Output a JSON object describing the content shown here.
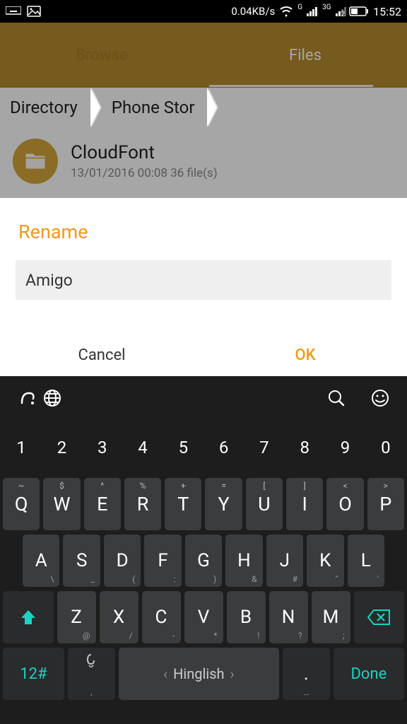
{
  "status": {
    "speed": "0.04KB/s",
    "g": "G",
    "net_label": "3G",
    "time": "15:52"
  },
  "tabs": {
    "browse": "Browse",
    "files": "Files"
  },
  "breadcrumb": {
    "first": "Directory",
    "second": "Phone Stor"
  },
  "file": {
    "name": "CloudFont",
    "meta": "13/01/2016 00:08  36 file(s)"
  },
  "dialog": {
    "title": "Rename",
    "value": "Amigo",
    "cancel": "Cancel",
    "ok": "OK"
  },
  "keyboard": {
    "nums": [
      "1",
      "2",
      "3",
      "4",
      "5",
      "6",
      "7",
      "8",
      "9",
      "0"
    ],
    "row1": [
      {
        "k": "Q",
        "s": "~"
      },
      {
        "k": "W",
        "s": "$"
      },
      {
        "k": "E",
        "s": "^"
      },
      {
        "k": "R",
        "s": "%"
      },
      {
        "k": "T",
        "s": "+"
      },
      {
        "k": "Y",
        "s": "="
      },
      {
        "k": "U",
        "s": "["
      },
      {
        "k": "I",
        "s": "]"
      },
      {
        "k": "O",
        "s": "<"
      },
      {
        "k": "P",
        "s": ">"
      }
    ],
    "row2": [
      {
        "k": "A",
        "b": "\\"
      },
      {
        "k": "S",
        "b": "_"
      },
      {
        "k": "D",
        "b": "("
      },
      {
        "k": "F",
        "b": ":"
      },
      {
        "k": "G",
        "b": ")"
      },
      {
        "k": "H",
        "b": "&"
      },
      {
        "k": "J",
        "b": "#"
      },
      {
        "k": "K",
        "b": "\""
      },
      {
        "k": "L",
        "b": "'"
      }
    ],
    "row3": [
      {
        "k": "Z",
        "b": "@"
      },
      {
        "k": "X",
        "b": "/"
      },
      {
        "k": "C",
        "b": "-"
      },
      {
        "k": "V",
        "b": "*"
      },
      {
        "k": "B",
        "b": "!"
      },
      {
        "k": "N",
        "b": "?"
      },
      {
        "k": "M",
        "b": ";"
      }
    ],
    "bottom": {
      "numswitch": "12#",
      "space": "Hinglish",
      "done": "Done",
      "comma": ",",
      "period": ".",
      "comma_sub": ",",
      "period_sub": "…"
    }
  }
}
